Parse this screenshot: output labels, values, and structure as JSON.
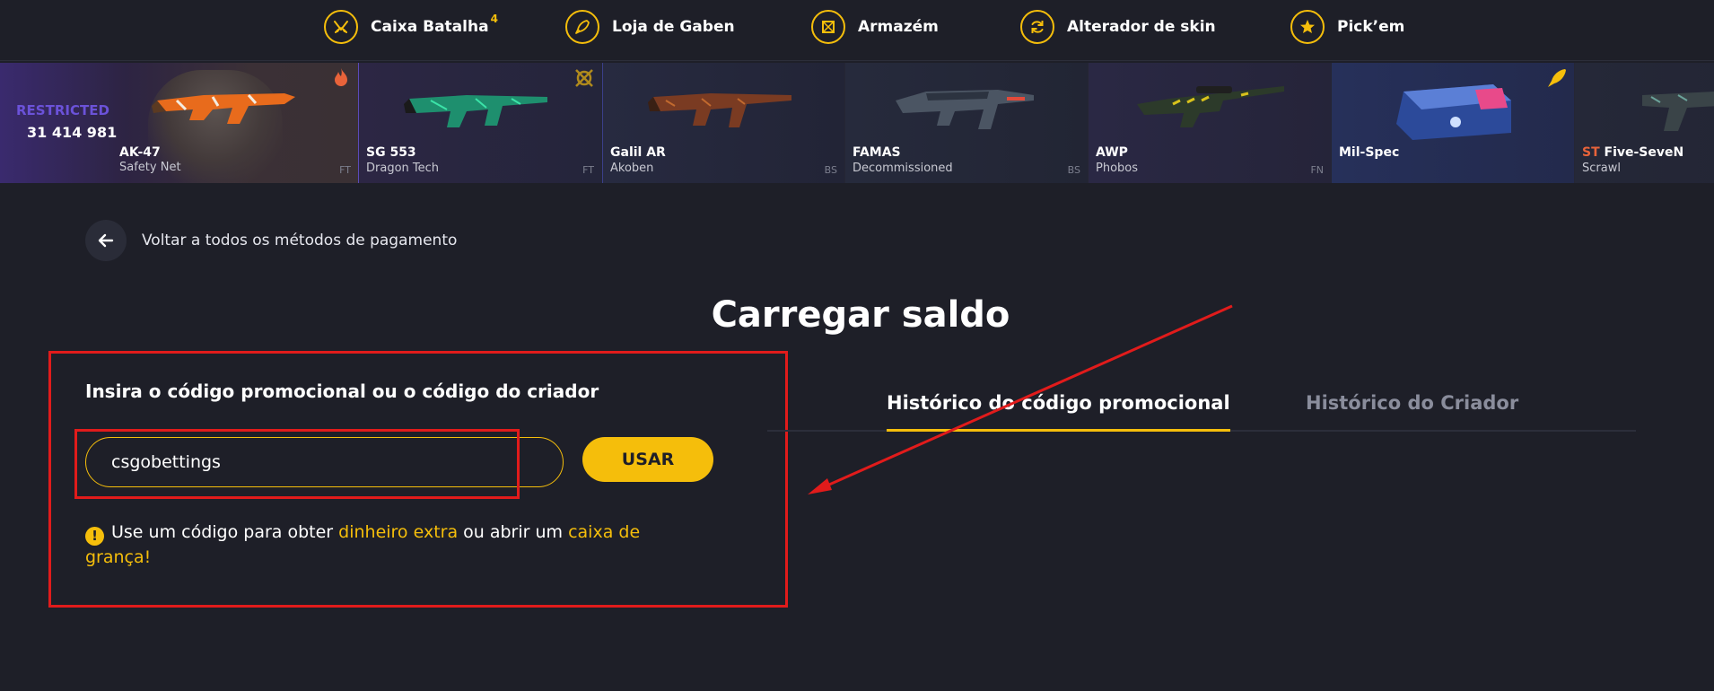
{
  "nav": {
    "items": [
      {
        "label": "Caixa Batalha",
        "badge": "4",
        "icon": "swords-icon"
      },
      {
        "label": "Loja de Gaben",
        "icon": "rocket-icon"
      },
      {
        "label": "Armazém",
        "icon": "box-icon"
      },
      {
        "label": "Alterador de skin",
        "icon": "refresh-icon"
      },
      {
        "label": "Pick’em",
        "icon": "star-icon"
      }
    ]
  },
  "drops": {
    "first": {
      "rarity": "RESTRICTED",
      "count": "31 414 981",
      "name": "AK-47",
      "skin": "Safety Net",
      "wear": "FT"
    },
    "items": [
      {
        "name": "SG 553",
        "skin": "Dragon Tech",
        "wear": "FT"
      },
      {
        "name": "Galil AR",
        "skin": "Akoben",
        "wear": "BS"
      },
      {
        "name": "FAMAS",
        "skin": "Decommissioned",
        "wear": "BS"
      },
      {
        "name": "AWP",
        "skin": "Phobos",
        "wear": "FN"
      },
      {
        "name": "Mil-Spec",
        "skin": "",
        "wear": ""
      },
      {
        "prefix": "ST",
        "name": "Five-SeveN",
        "skin": "Scrawl",
        "wear": ""
      }
    ]
  },
  "back": {
    "label": "Voltar a todos os métodos de pagamento"
  },
  "page": {
    "title": "Carregar saldo"
  },
  "promo": {
    "heading": "Insira o código promocional ou o código do criador",
    "input_value": "csgobettings",
    "use_button": "USAR",
    "hint_icon": "!",
    "hint_part1": "Use um código para obter ",
    "hint_highlight1": "dinheiro extra",
    "hint_part2": " ou abrir um ",
    "hint_highlight2": "caixa de grança!"
  },
  "tabs": {
    "promo_history": "Histórico do código promocional",
    "creator_history": "Histórico do Criador"
  },
  "colors": {
    "accent": "#f5be0b",
    "background": "#1e1f28",
    "annotation": "#e11b1b",
    "restricted": "#6b52d9"
  }
}
